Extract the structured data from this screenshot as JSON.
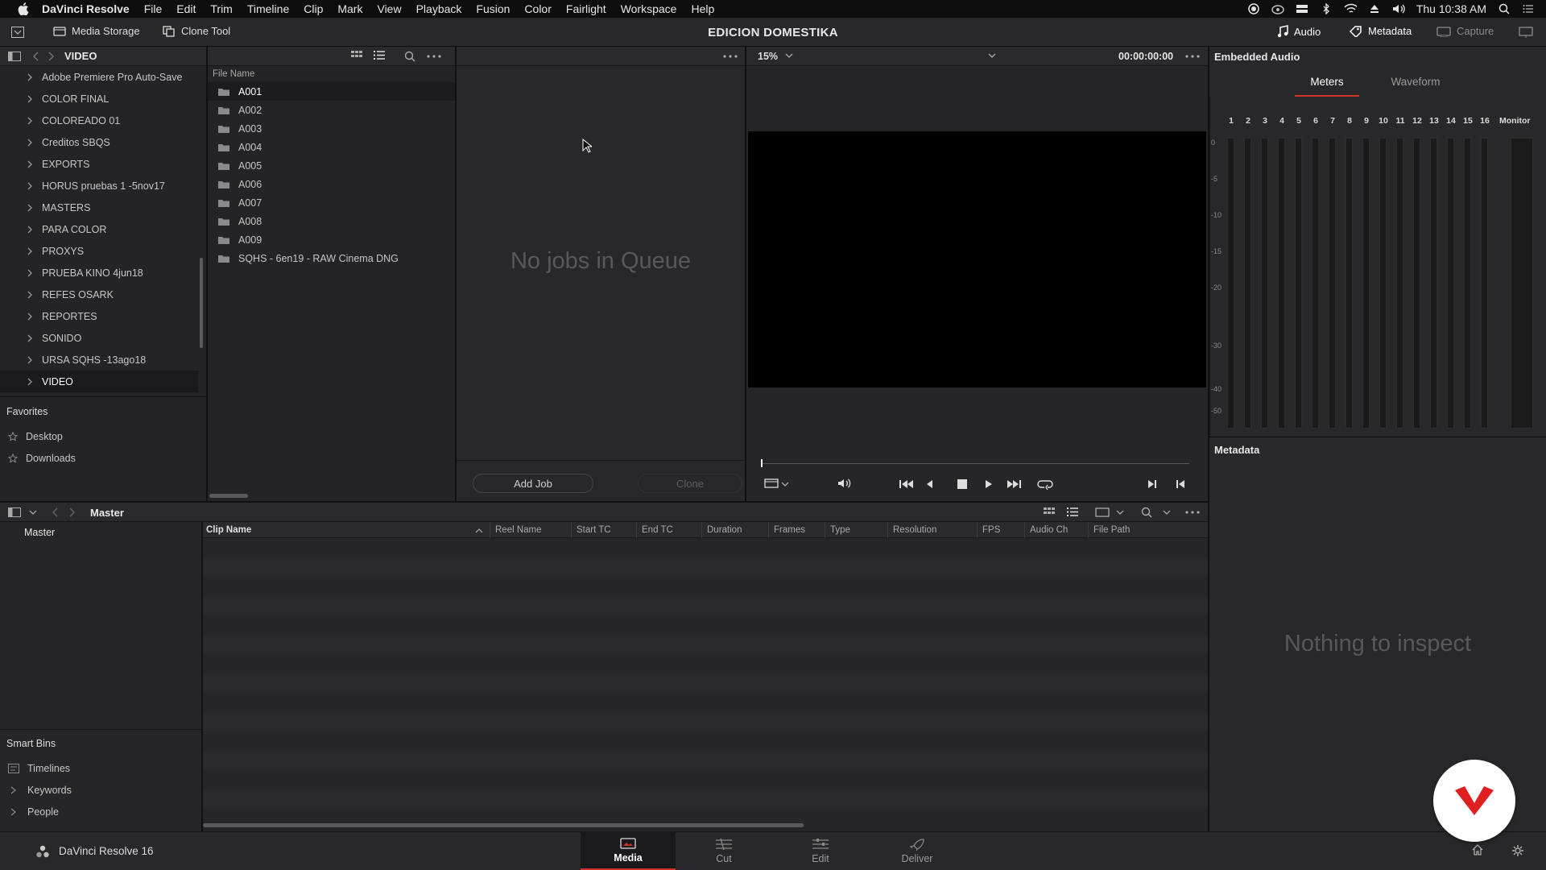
{
  "menubar": {
    "app_name": "DaVinci Resolve",
    "items": [
      "File",
      "Edit",
      "Trim",
      "Timeline",
      "Clip",
      "Mark",
      "View",
      "Playback",
      "Fusion",
      "Color",
      "Fairlight",
      "Workspace",
      "Help"
    ],
    "clock": "Thu 10:38 AM"
  },
  "toolbar": {
    "media_storage": "Media Storage",
    "clone_tool": "Clone Tool",
    "project_title": "EDICION DOMESTIKA",
    "audio": "Audio",
    "metadata": "Metadata",
    "capture": "Capture"
  },
  "storage": {
    "location": "VIDEO",
    "folders": [
      "Adobe Premiere Pro Auto-Save",
      "COLOR FINAL",
      "COLOREADO 01",
      "Creditos SBQS",
      "EXPORTS",
      "HORUS pruebas 1 -5nov17",
      "MASTERS",
      "PARA COLOR",
      "PROXYS",
      "PRUEBA KINO 4jun18",
      "REFES OSARK",
      "REPORTES",
      "SONIDO",
      "URSA SQHS -13ago18",
      "VIDEO"
    ],
    "selected_folder": "VIDEO",
    "favorites_title": "Favorites",
    "favorites": [
      "Desktop",
      "Downloads"
    ]
  },
  "files": {
    "column": "File Name",
    "items": [
      "A001",
      "A002",
      "A003",
      "A004",
      "A005",
      "A006",
      "A007",
      "A008",
      "A009",
      "SQHS - 6en19 - RAW Cinema DNG"
    ],
    "selected": "A001"
  },
  "clone": {
    "empty_text": "No jobs in Queue",
    "add_job": "Add Job",
    "clone_btn": "Clone"
  },
  "viewer": {
    "zoom": "15%",
    "timecode": "00:00:00:00"
  },
  "audio_panel": {
    "title": "Embedded Audio",
    "tabs": [
      "Meters",
      "Waveform"
    ],
    "active_tab": "Meters",
    "channels": [
      "1",
      "2",
      "3",
      "4",
      "5",
      "6",
      "7",
      "8",
      "9",
      "10",
      "11",
      "12",
      "13",
      "14",
      "15",
      "16"
    ],
    "monitor_label": "Monitor",
    "db_scale": [
      "0",
      "-5",
      "-10",
      "-15",
      "-20",
      "-30",
      "-40",
      "-50"
    ]
  },
  "metadata_panel": {
    "title": "Metadata",
    "empty_text": "Nothing to inspect"
  },
  "media_pool": {
    "breadcrumb": "Master",
    "bins": [
      "Master"
    ],
    "columns": [
      "Clip Name",
      "Reel Name",
      "Start TC",
      "End TC",
      "Duration",
      "Frames",
      "Type",
      "Resolution",
      "FPS",
      "Audio Ch",
      "File Path"
    ],
    "smart_bins_title": "Smart Bins",
    "smart_bins": [
      "Timelines",
      "Keywords",
      "People"
    ]
  },
  "footer": {
    "product": "DaVinci Resolve 16",
    "pages": [
      "Media",
      "Cut",
      "Edit",
      "Deliver"
    ],
    "active_page": "Media"
  },
  "colors": {
    "accent_red": "#d0312d",
    "logo_red": "#e02020"
  }
}
